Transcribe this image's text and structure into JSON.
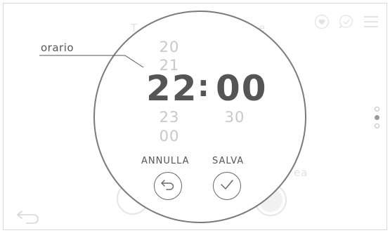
{
  "field_label": "orario",
  "picker": {
    "hours": {
      "above": [
        "20",
        "21"
      ],
      "selected": "22",
      "below": [
        "23",
        "00"
      ]
    },
    "separator": ":",
    "minutes": {
      "above": [],
      "selected": "00",
      "below": [
        "30"
      ]
    }
  },
  "actions": {
    "cancel_label": "ANNULLA",
    "save_label": "SALVA"
  },
  "background": {
    "title_fragment_left": "T",
    "title_fragment_right": "e",
    "label_fragment": "ea"
  },
  "pager": {
    "count": 3,
    "active_index": 1
  },
  "icons": {
    "top_left": "heart-badge-icon",
    "top_middle": "chat-check-icon",
    "top_right": "menu-icon",
    "cancel": "undo-icon",
    "save": "check-icon",
    "bottom_left": "back-arrow-icon"
  },
  "colors": {
    "accent": "#555555",
    "muted": "#c8c8c8",
    "line": "#7a7a7a"
  }
}
